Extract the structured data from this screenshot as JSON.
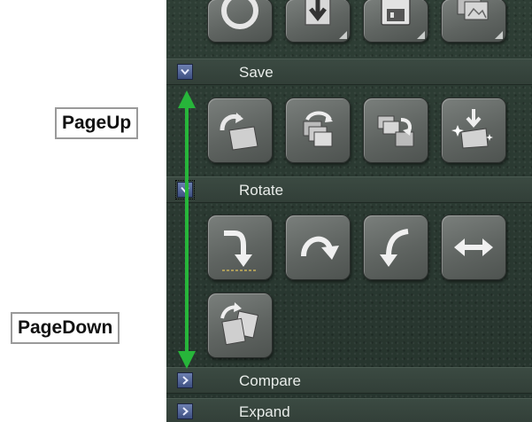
{
  "sections": {
    "save": {
      "label": "Save"
    },
    "rotate": {
      "label": "Rotate"
    },
    "compare": {
      "label": "Compare"
    },
    "expand": {
      "label": "Expand"
    }
  },
  "annotations": {
    "page_up": "PageUp",
    "page_down": "PageDown",
    "arrow_color": "#27b53a"
  },
  "colors": {
    "panel_background": "#2a3a32",
    "section_bar": "#36443d",
    "section_text": "#e8ece9",
    "toggle_box": "#4d5f95",
    "button_face": "#646966"
  },
  "icons": {
    "top_row": [
      "circle-tool-icon",
      "download-export-icon",
      "floppy-save-icon",
      "image-stack-icon"
    ],
    "save_row": [
      "open-folder-icon",
      "copy-files-icon",
      "move-files-icon",
      "import-sparkle-icon"
    ],
    "rotate_row": [
      "rotate-right-arrow-icon",
      "rotate-clockwise-icon",
      "rotate-counterclockwise-icon",
      "flip-horizontal-icon",
      "auto-rotate-icon"
    ]
  }
}
